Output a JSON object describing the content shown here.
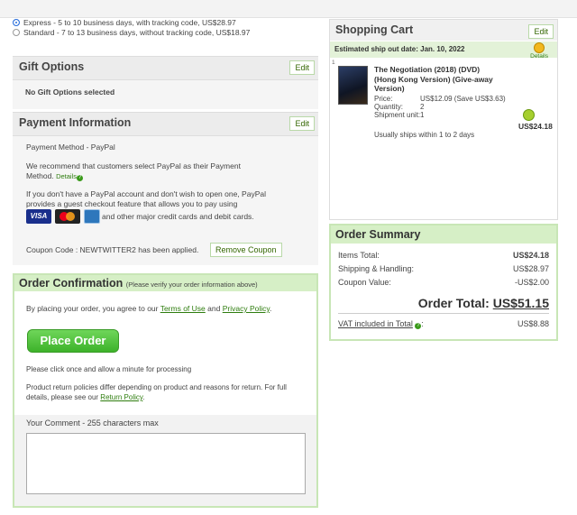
{
  "shipping_options": [
    {
      "label": "Express  -  5 to 10 business days, with tracking code, US$28.97",
      "selected": true
    },
    {
      "label": "Standard  -  7 to 13 business days, without tracking code, US$18.97",
      "selected": false
    }
  ],
  "gift": {
    "title": "Gift Options",
    "edit": "Edit",
    "text": "No Gift Options selected"
  },
  "payment": {
    "title": "Payment Information",
    "edit": "Edit",
    "method": "Payment Method  -  PayPal",
    "recommend_1": "We recommend that customers select PayPal as their Payment",
    "recommend_2": "Method.",
    "details": "Details",
    "info_1": "If you don't have a PayPal account and don't wish to open one, PayPal",
    "info_2": "provides a guest checkout feature that allows you to pay using",
    "cards_text": "and other major credit cards and debit cards.",
    "visa": "VISA",
    "coupon_text": "Coupon Code : NEWTWITTER2 has been applied.",
    "remove_coupon": "Remove Coupon"
  },
  "confirmation": {
    "title": "Order Confirmation",
    "subtitle": "(Please verify your order information above)",
    "agree_pre": "By placing your order, you agree to our",
    "terms": "Terms of Use",
    "and": "and",
    "privacy": "Privacy Policy",
    "period": ".",
    "place_order": "Place Order",
    "click_once": "Please click once and allow a minute for processing",
    "return_1": "Product return policies differ depending on product and reasons for return. For full",
    "return_2": "details, please see our",
    "return_policy": "Return Policy",
    "comment_label": "Your Comment - 255 characters max"
  },
  "cart": {
    "title": "Shopping Cart",
    "edit": "Edit",
    "ship_date": "Estimated ship out date: Jan. 10, 2022",
    "details": "Details",
    "item_index": "1",
    "item_title_1": "The Negotiation (2018) (DVD)",
    "item_title_2": "(Hong Kong Version) (Give-away",
    "item_title_3": "Version)",
    "price_label": "Price:",
    "price_value": "US$12.09 (Save US$3.63)",
    "qty_label": "Quantity:",
    "qty_value": "2",
    "unit_label": "Shipment unit:",
    "unit_value": "1",
    "item_total": "US$24.18",
    "ships_note": "Usually ships within 1 to 2 days"
  },
  "summary": {
    "title": "Order Summary",
    "items_label": "Items Total:",
    "items_value": "US$24.18",
    "shipping_label": "Shipping & Handling:",
    "shipping_value": "US$28.97",
    "coupon_label": "Coupon Value:",
    "coupon_value": "-US$2.00",
    "total_label": "Order Total:",
    "total_value": "US$51.15",
    "vat_label": "VAT included in Total",
    "vat_colon": ":",
    "vat_value": "US$8.88"
  }
}
